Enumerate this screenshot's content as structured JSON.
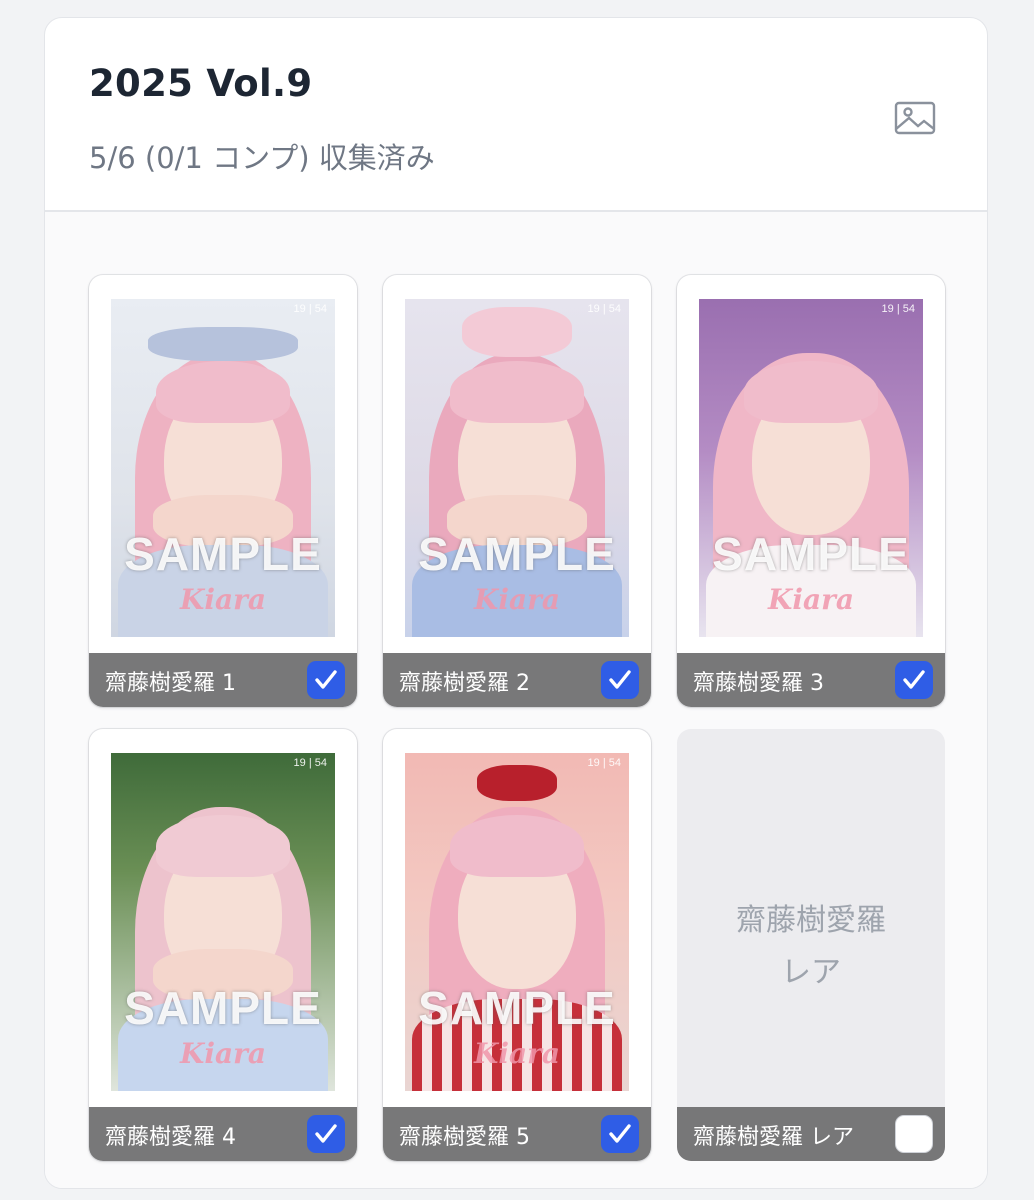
{
  "header": {
    "title": "2025 Vol.9",
    "subtitle": "5/6 (0/1 コンプ) 収集済み",
    "image_icon": "image-icon"
  },
  "photo_overlay": {
    "sample_text": "SAMPLE",
    "name_script": "Kiara"
  },
  "cards": [
    {
      "label": "齋藤樹愛羅 1",
      "checked": true,
      "corner_text": "19 | 54"
    },
    {
      "label": "齋藤樹愛羅 2",
      "checked": true,
      "corner_text": "19 | 54"
    },
    {
      "label": "齋藤樹愛羅 3",
      "checked": true,
      "corner_text": "19 | 54"
    },
    {
      "label": "齋藤樹愛羅 4",
      "checked": true,
      "corner_text": "19 | 54"
    },
    {
      "label": "齋藤樹愛羅 5",
      "checked": true,
      "corner_text": "19 | 54"
    },
    {
      "label": "齋藤樹愛羅 レア",
      "checked": false,
      "placeholder_line1": "齋藤樹愛羅",
      "placeholder_line2": "レア"
    }
  ],
  "colors": {
    "accent": "#2f5de6",
    "label_bar": "#6c6c6e",
    "hair_pink": "#eeb2c2"
  }
}
